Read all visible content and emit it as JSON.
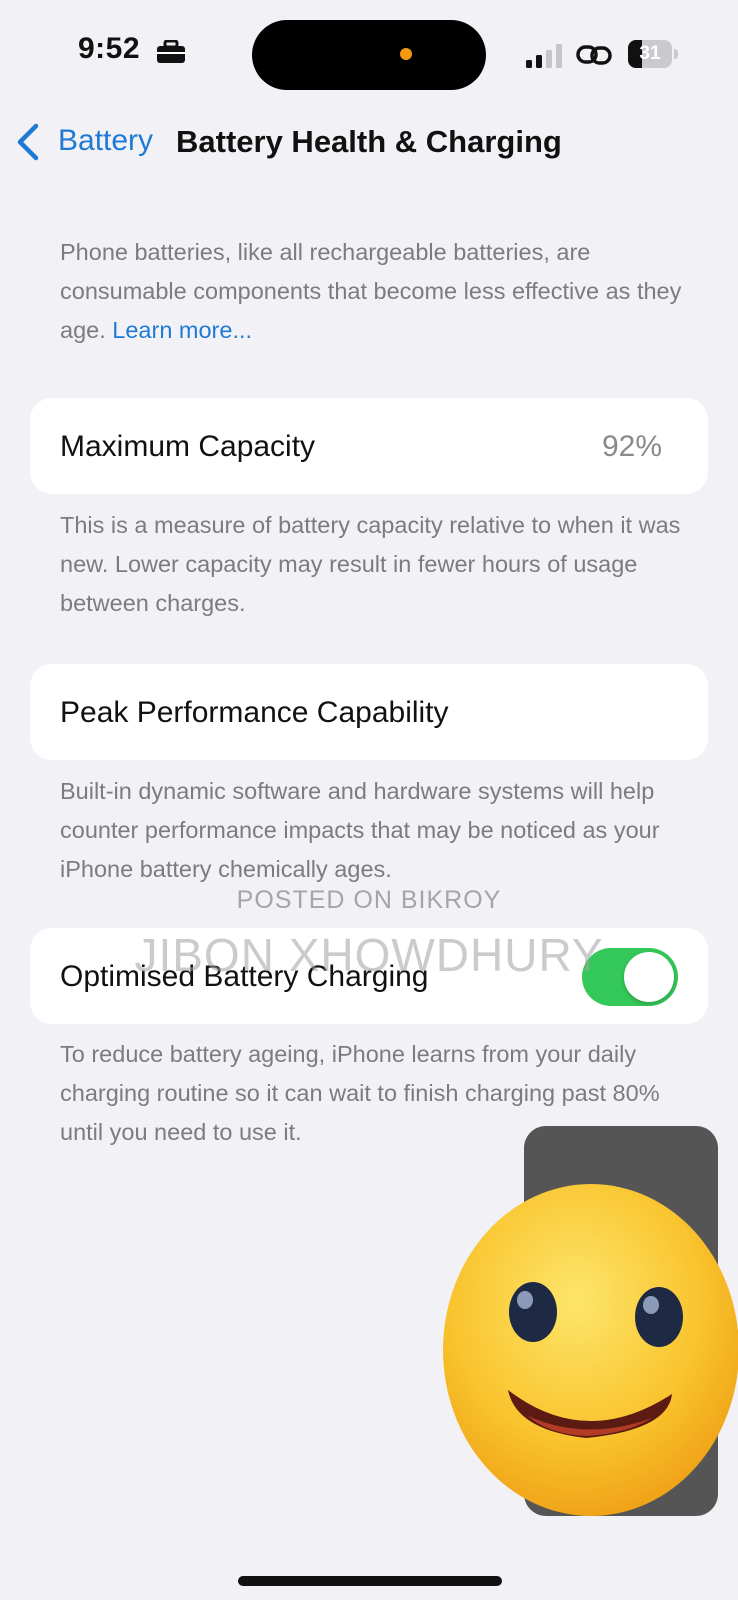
{
  "status_bar": {
    "time": "9:52",
    "battery_level": "31",
    "battery_fraction": 0.31
  },
  "nav": {
    "back_label": "Battery",
    "title": "Battery Health & Charging"
  },
  "intro": {
    "text": "Phone batteries, like all rechargeable batteries, are consumable components that become less effective as they age. ",
    "link": "Learn more..."
  },
  "max_capacity": {
    "label": "Maximum Capacity",
    "value": "92%",
    "footnote": "This is a measure of battery capacity relative to when it was new. Lower capacity may result in fewer hours of usage between charges."
  },
  "peak_performance": {
    "label": "Peak Performance Capability",
    "footnote": "Built-in dynamic software and hardware systems will help counter performance impacts that may be noticed as your iPhone battery chemically ages."
  },
  "optimised_charging": {
    "label": "Optimised Battery Charging",
    "enabled": true,
    "footnote": "To reduce battery ageing, iPhone learns from your daily charging routine so it can wait to finish charging past 80% until you need to use it."
  },
  "watermark": {
    "line1": "POSTED ON BIKROY",
    "line2": "JIBON XHOWDHURY"
  },
  "colors": {
    "accent": "#1f7ad6",
    "toggle_on": "#34c759",
    "background": "#f2f2f6"
  },
  "icons": [
    "briefcase-icon",
    "signal-icon",
    "link-icon",
    "battery-icon",
    "chevron-left-icon",
    "smiley-emoji"
  ]
}
